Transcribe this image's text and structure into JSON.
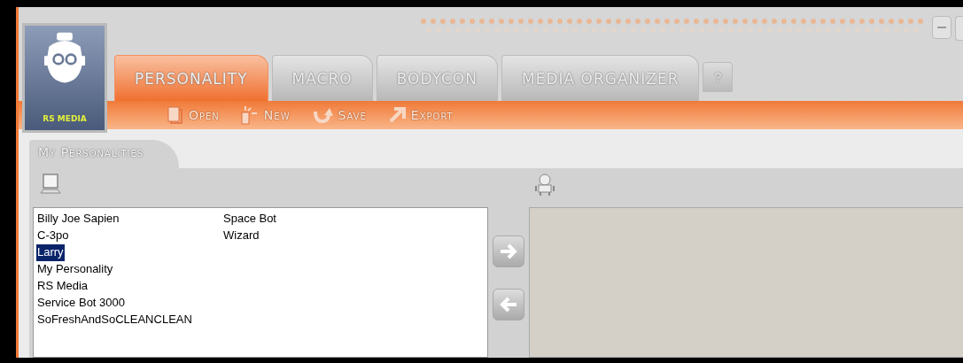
{
  "logo": {
    "label": "RS MEDIA"
  },
  "tabs": [
    {
      "label": "PERSONALITY",
      "selected": true
    },
    {
      "label": "MACRO",
      "selected": false
    },
    {
      "label": "BODYCON",
      "selected": false
    },
    {
      "label": "MEDIA ORGANIZER",
      "selected": false
    }
  ],
  "help_button": "?",
  "toolbar": [
    {
      "kind": "open",
      "label": "Open"
    },
    {
      "kind": "new",
      "label": "New"
    },
    {
      "kind": "save",
      "label": "Save"
    },
    {
      "kind": "export",
      "label": "Export"
    }
  ],
  "section_tab": "My Personalities",
  "personalities": [
    {
      "name": "Billy Joe Sapien",
      "selected": false
    },
    {
      "name": "C-3po",
      "selected": false
    },
    {
      "name": "Larry",
      "selected": true
    },
    {
      "name": "My Personality",
      "selected": false
    },
    {
      "name": "RS Media",
      "selected": false
    },
    {
      "name": "Service Bot 3000",
      "selected": false
    },
    {
      "name": "SoFreshAndSoCLEANCLEAN",
      "selected": false
    },
    {
      "name": "Space Bot",
      "selected": false
    },
    {
      "name": "Wizard",
      "selected": false
    }
  ]
}
